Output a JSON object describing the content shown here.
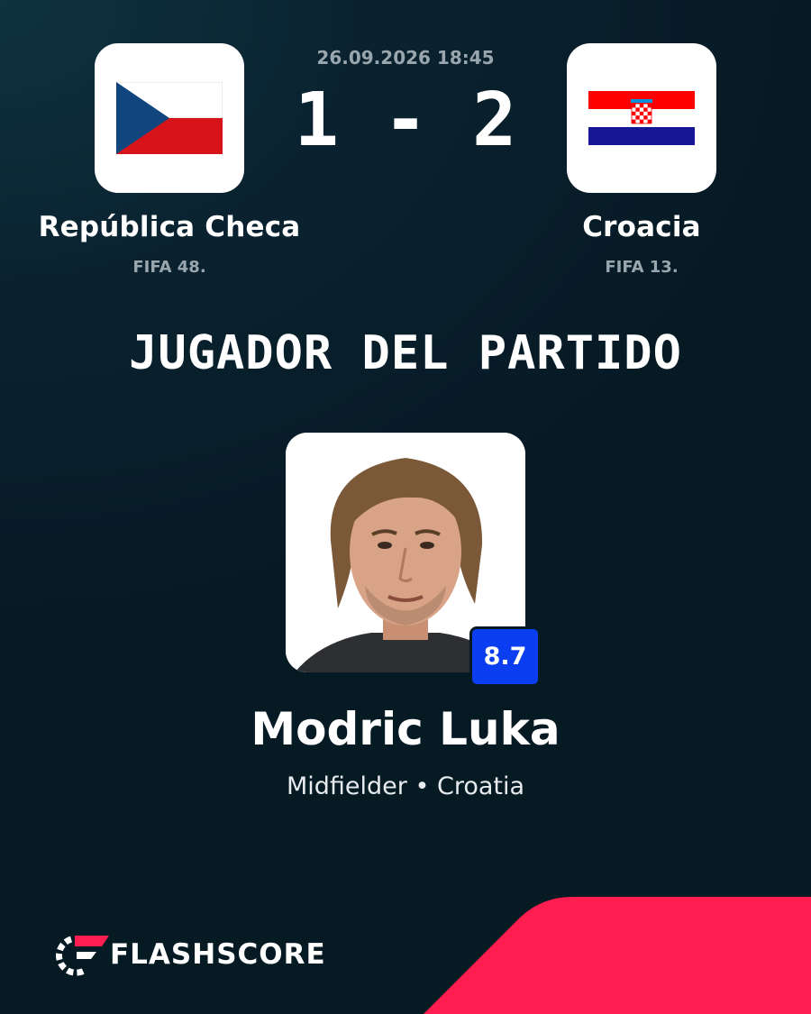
{
  "match": {
    "datetime": "26.09.2026 18:45",
    "score": "1 - 2"
  },
  "home_team": {
    "name": "República Checa",
    "rank": "FIFA 48.",
    "flag": "czech-republic-flag"
  },
  "away_team": {
    "name": "Croacia",
    "rank": "FIFA 13.",
    "flag": "croatia-flag"
  },
  "award": {
    "title": "JUGADOR DEL PARTIDO"
  },
  "player": {
    "name": "Modric Luka",
    "position_country": "Midfielder • Croatia",
    "rating": "8.7"
  },
  "brand": {
    "name": "FLASHSCORE",
    "accent_color": "#ff1e4f",
    "rating_color": "#0b3ef0"
  }
}
